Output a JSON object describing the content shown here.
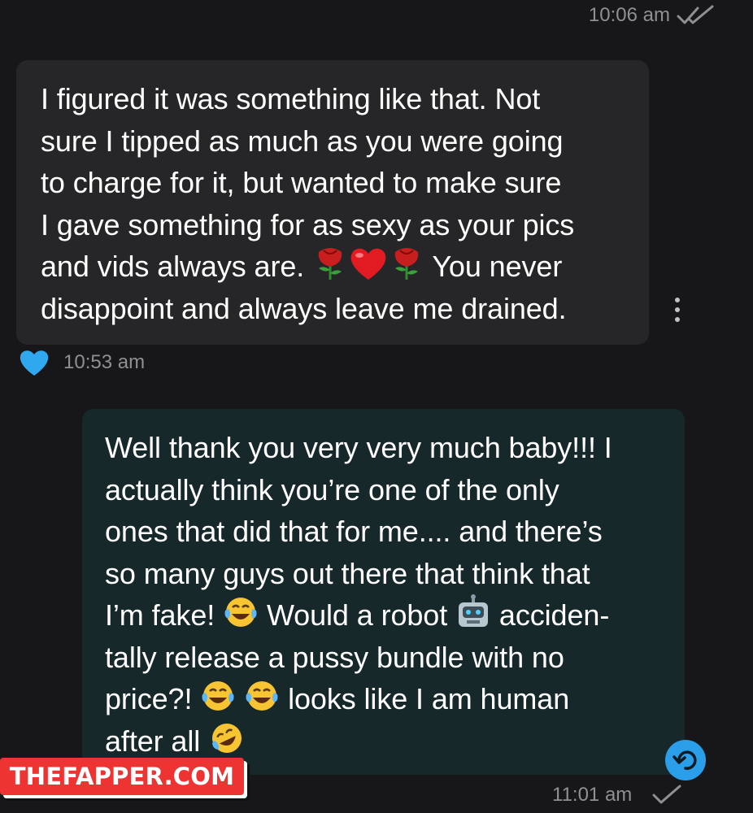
{
  "messages": [
    {
      "direction": "sent",
      "time": "10:06 am",
      "status": "read"
    },
    {
      "direction": "received",
      "line1": "I figured it was something like that. Not",
      "line2": "sure I tipped as much as you were going",
      "line3": "to charge for it, but wanted to make sure",
      "line4": "I gave something for as sexy as your pics",
      "line5a": "and vids always are. ",
      "line5b": " You never",
      "line6": "disappoint and always leave me drained.",
      "emojis": [
        "rose-icon",
        "heart-icon",
        "rose-icon"
      ],
      "reaction": "blue-heart-icon",
      "time": "10:53 am"
    },
    {
      "direction": "sent",
      "line1": "Well thank you very very much baby!!! I",
      "line2": "actually think you’re one of the only",
      "line3": "ones that did that for me.... and there’s",
      "line4": "so many guys out there that think that",
      "line5a": "I’m fake! ",
      "line5b": " Would a robot ",
      "line5c": " acciden-",
      "line6": "tally release a pussy bundle with no",
      "line7a": "price?! ",
      "line7b": " looks like I am human",
      "line8a": "after all ",
      "time": "11:01 am",
      "status": "sent"
    }
  ],
  "watermark": "THEFAPPER.COM",
  "colors": {
    "background": "#171719",
    "incoming_bubble": "#262629",
    "outgoing_bubble": "#17282b",
    "timestamp": "#8e9092",
    "accent_blue": "#2a9ee8",
    "watermark_red": "#e33333"
  }
}
